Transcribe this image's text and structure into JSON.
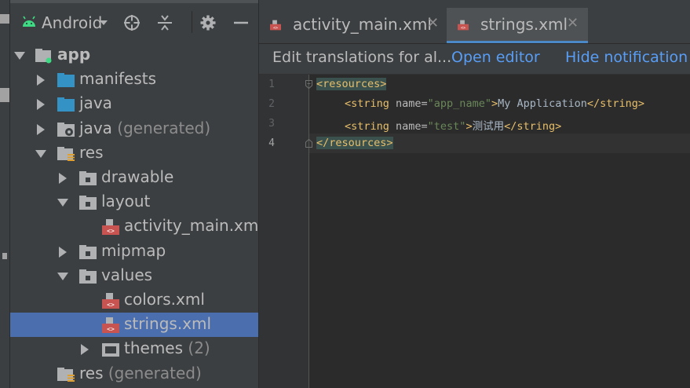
{
  "project_pane": {
    "view_title": "Android",
    "toolbar_icons": [
      "crosshair-icon",
      "collapse-all-icon",
      "gear-icon",
      "minimize-icon"
    ],
    "tree": [
      {
        "label": "app",
        "suffix": "",
        "icon": "module-folder-icon",
        "expanded": true,
        "level": 0,
        "bold": true
      },
      {
        "label": "manifests",
        "suffix": "",
        "icon": "folder-icon",
        "expanded": false,
        "level": 1
      },
      {
        "label": "java",
        "suffix": "",
        "icon": "folder-icon",
        "expanded": false,
        "level": 1
      },
      {
        "label": "java",
        "suffix": " (generated)",
        "icon": "generated-folder-icon",
        "expanded": false,
        "level": 1
      },
      {
        "label": "res",
        "suffix": "",
        "icon": "res-folder-icon",
        "expanded": true,
        "level": 1
      },
      {
        "label": "drawable",
        "suffix": "",
        "icon": "package-folder-icon",
        "expanded": false,
        "level": 2
      },
      {
        "label": "layout",
        "suffix": "",
        "icon": "package-folder-icon",
        "expanded": true,
        "level": 2
      },
      {
        "label": "activity_main.xml",
        "suffix": "",
        "icon": "xml-file-icon",
        "level": 3
      },
      {
        "label": "mipmap",
        "suffix": "",
        "icon": "package-folder-icon",
        "expanded": false,
        "level": 2
      },
      {
        "label": "values",
        "suffix": "",
        "icon": "package-folder-icon",
        "expanded": true,
        "level": 2
      },
      {
        "label": "colors.xml",
        "suffix": "",
        "icon": "xml-file-icon",
        "level": 3
      },
      {
        "label": "strings.xml",
        "suffix": "",
        "icon": "xml-file-icon",
        "level": 3,
        "selected": true
      },
      {
        "label": "themes",
        "suffix": " (2)",
        "icon": "xml-group-icon",
        "expanded": false,
        "level": 3
      },
      {
        "label": "res",
        "suffix": " (generated)",
        "icon": "res-folder-icon",
        "level": 1
      }
    ]
  },
  "editor": {
    "tabs": [
      {
        "label": "activity_main.xml",
        "active": false
      },
      {
        "label": "strings.xml",
        "active": true
      }
    ],
    "notification": {
      "text": "Edit translations for al...",
      "open_editor": "Open editor",
      "hide_notification": "Hide notification"
    },
    "line_numbers": [
      "1",
      "2",
      "3",
      "4"
    ],
    "code": {
      "line1": {
        "open": "<resources>"
      },
      "line2": {
        "tag": "<string ",
        "attr": "name=",
        "val": "\"app_name\"",
        "gt": ">",
        "text": "My Application",
        "close": "</string>"
      },
      "line3": {
        "tag": "<string ",
        "attr": "name=",
        "val": "\"test\"",
        "gt": ">",
        "text": "测试用",
        "close": "</string>"
      },
      "line4": {
        "close": "</resources>"
      }
    }
  },
  "colors": {
    "selection": "#4b6eaf",
    "folder_blue": "#3592c4",
    "xml_orange": "#c75450",
    "link": "#589df6"
  }
}
